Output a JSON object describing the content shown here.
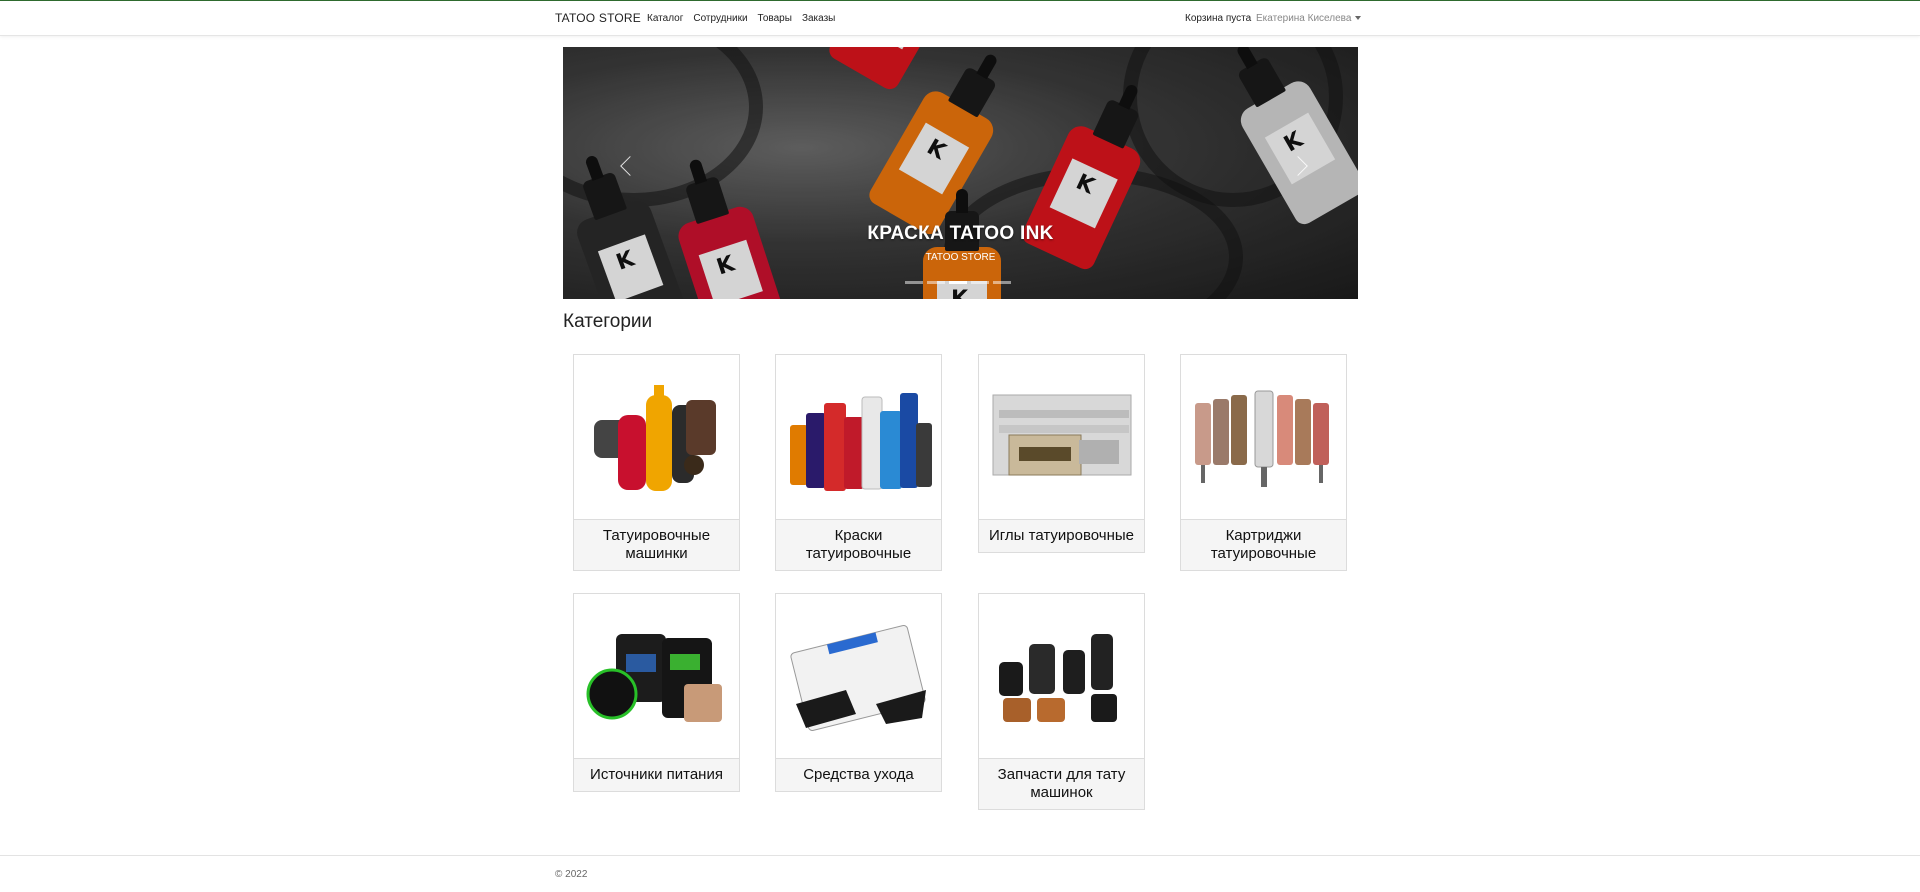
{
  "navbar": {
    "brand": "TATOO STORE",
    "links": [
      "Каталог",
      "Сотрудники",
      "Товары",
      "Заказы"
    ],
    "cart": "Корзина пуста",
    "user": "Екатерина Киселева"
  },
  "carousel": {
    "title": "КРАСКА TATOO INK",
    "subtitle": "TATOO STORE",
    "slides": 5,
    "active_slide": 3
  },
  "categories": {
    "title": "Категории",
    "items": [
      {
        "label": "Татуировочные машинки",
        "icon": "tattoo-machines-image"
      },
      {
        "label": "Краски татуировочные",
        "icon": "tattoo-inks-image"
      },
      {
        "label": "Иглы татуировочные",
        "icon": "tattoo-needles-image"
      },
      {
        "label": "Картриджи татуировочные",
        "icon": "tattoo-cartridges-image"
      },
      {
        "label": "Источники питания",
        "icon": "power-supplies-image"
      },
      {
        "label": "Средства ухода",
        "icon": "care-products-image"
      },
      {
        "label": "Запчасти для тату машинок",
        "icon": "machine-parts-image"
      }
    ]
  },
  "footer": {
    "copyright": "© 2022"
  },
  "colors": {
    "accent_line": "#2f6b2f",
    "card_label_bg": "#f5f5f5"
  }
}
